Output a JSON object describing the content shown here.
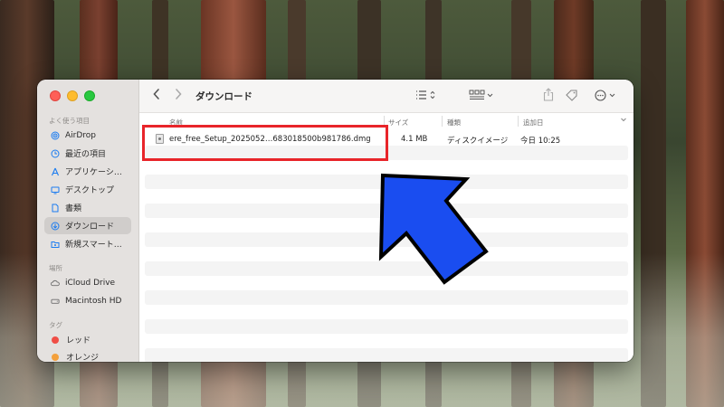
{
  "window": {
    "title": "ダウンロード"
  },
  "sidebar": {
    "favorites_title": "よく使う項目",
    "favorites": [
      {
        "label": "AirDrop",
        "icon": "airdrop-icon"
      },
      {
        "label": "最近の項目",
        "icon": "clock-icon"
      },
      {
        "label": "アプリケーシ…",
        "icon": "applications-icon"
      },
      {
        "label": "デスクトップ",
        "icon": "desktop-icon"
      },
      {
        "label": "書類",
        "icon": "document-icon"
      },
      {
        "label": "ダウンロード",
        "icon": "download-icon",
        "selected": true
      },
      {
        "label": "新規スマート…",
        "icon": "smart-folder-icon"
      }
    ],
    "locations_title": "場所",
    "locations": [
      {
        "label": "iCloud Drive",
        "icon": "cloud-icon"
      },
      {
        "label": "Macintosh HD",
        "icon": "disk-icon"
      }
    ],
    "tags_title": "タグ",
    "tags": [
      {
        "label": "レッド",
        "color": "#f04e46"
      },
      {
        "label": "オレンジ",
        "color": "#f3a03c"
      }
    ]
  },
  "columns": {
    "name": "名前",
    "size": "サイズ",
    "kind": "種類",
    "date_added": "追加日"
  },
  "files": [
    {
      "name": "ere_free_Setup_2025052…683018500b981786.dmg",
      "size": "4.1 MB",
      "kind": "ディスクイメージ",
      "date_added": "今日 10:25"
    }
  ],
  "colors": {
    "highlight": "#e8252a",
    "arrow": "#1a4df0",
    "selection": "#d0cdcb"
  }
}
